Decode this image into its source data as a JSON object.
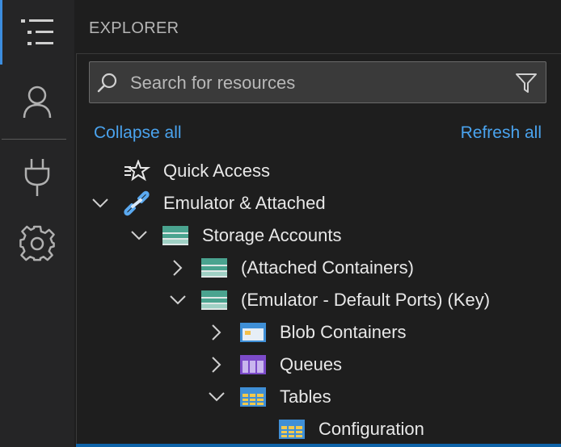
{
  "panel": {
    "title": "EXPLORER"
  },
  "search": {
    "placeholder": "Search for resources",
    "value": ""
  },
  "actions": {
    "collapse_all": "Collapse all",
    "refresh_all": "Refresh all"
  },
  "activity_bar": [
    "explorer-icon",
    "account-icon",
    "plug-icon",
    "gear-icon"
  ],
  "tree": [
    {
      "label": "Quick Access",
      "expanded": null,
      "icon": "quick-access-icon"
    },
    {
      "label": "Emulator & Attached",
      "expanded": true,
      "icon": "link-icon"
    },
    {
      "label": "Storage Accounts",
      "expanded": true,
      "icon": "storage-account-icon"
    },
    {
      "label": "(Attached Containers)",
      "expanded": false,
      "icon": "storage-account-icon"
    },
    {
      "label": "(Emulator - Default Ports) (Key)",
      "expanded": true,
      "icon": "storage-account-icon"
    },
    {
      "label": "Blob Containers",
      "expanded": false,
      "icon": "blob-container-icon"
    },
    {
      "label": "Queues",
      "expanded": false,
      "icon": "queue-icon"
    },
    {
      "label": "Tables",
      "expanded": true,
      "icon": "table-icon"
    },
    {
      "label": "Configuration",
      "expanded": null,
      "icon": "table-icon"
    }
  ],
  "colors": {
    "accent": "#3c8dde",
    "link": "#4aa3ee",
    "background": "#1e1e1e"
  }
}
